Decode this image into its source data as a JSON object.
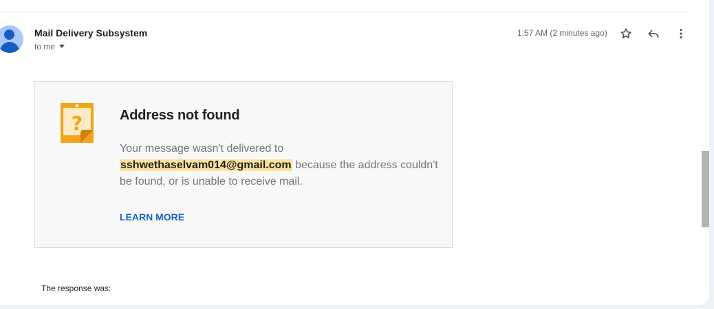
{
  "email": {
    "sender_name": "Mail Delivery Subsystem",
    "recipient_label": "to me",
    "timestamp": "1:57 AM (2 minutes ago)"
  },
  "icons": {
    "star": "star-icon",
    "reply": "reply-icon",
    "more": "more-vert-icon",
    "warning": "question-note-icon"
  },
  "card": {
    "title": "Address not found",
    "message_before": "Your message wasn't delivered to ",
    "email_address": "sshwethaselvam014@gmail.com",
    "message_after": " because the address couldn't be found, or is unable to receive mail.",
    "link": "LEARN MORE"
  },
  "footer": {
    "response_text": "The response was:"
  },
  "colors": {
    "link": "#1a62c4",
    "highlight": "#fbe39b",
    "warning_icon": "#f4a21a",
    "avatar_bg": "#a8c7fa",
    "avatar_fg": "#1a5ac5"
  }
}
